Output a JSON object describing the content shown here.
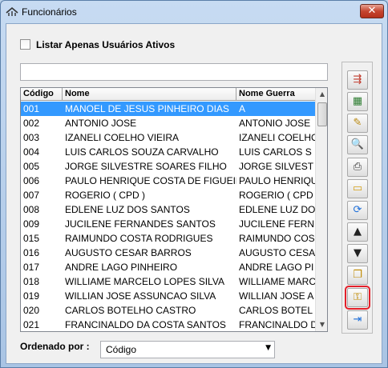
{
  "window": {
    "title": "Funcionários",
    "close_glyph": "✕"
  },
  "filter": {
    "active_only_label": "Listar Apenas Usuários Ativos",
    "active_only_checked": false
  },
  "search": {
    "value": "",
    "placeholder": ""
  },
  "table": {
    "columns": [
      "Código",
      "Nome",
      "Nome Guerra"
    ],
    "selected_row": 0,
    "rows": [
      [
        "001",
        "MANOEL DE JESUS PINHEIRO DIAS",
        "A"
      ],
      [
        "002",
        "ANTONIO JOSE",
        "ANTONIO JOSE"
      ],
      [
        "003",
        "IZANELI COELHO VIEIRA",
        "IZANELI COELHO"
      ],
      [
        "004",
        "LUIS CARLOS SOUZA CARVALHO",
        "LUIS CARLOS S"
      ],
      [
        "005",
        "JORGE SILVESTRE SOARES FILHO",
        "JORGE SILVEST"
      ],
      [
        "006",
        "PAULO HENRIQUE COSTA DE FIGUEIRI",
        "PAULO HENRIQU"
      ],
      [
        "007",
        "ROGERIO ( CPD )",
        "ROGERIO ( CPD"
      ],
      [
        "008",
        "EDLENE LUZ DOS SANTOS",
        "EDLENE LUZ DO"
      ],
      [
        "009",
        "JUCILENE FERNANDES SANTOS",
        "JUCILENE FERN"
      ],
      [
        "015",
        "RAIMUNDO COSTA RODRIGUES",
        "RAIMUNDO COS"
      ],
      [
        "016",
        "AUGUSTO CESAR BARROS",
        "AUGUSTO CESA"
      ],
      [
        "017",
        "ANDRE LAGO PINHEIRO",
        "ANDRE LAGO PI"
      ],
      [
        "018",
        "WILLIAME MARCELO LOPES SILVA",
        "WILLIAME MARC"
      ],
      [
        "019",
        "WILLIAN JOSE ASSUNCAO SILVA",
        "WILLIAN JOSE A"
      ],
      [
        "020",
        "CARLOS BOTELHO CASTRO",
        "CARLOS BOTEL"
      ],
      [
        "021",
        "FRANCINALDO DA COSTA SANTOS",
        "FRANCINALDO D"
      ]
    ]
  },
  "toolbar": {
    "buttons": [
      {
        "name": "insert-row-button",
        "icon": "insert-row-icon",
        "glyph": "⇶",
        "color": "#c0392b"
      },
      {
        "name": "edit-record-button",
        "icon": "edit-grid-icon",
        "glyph": "▦",
        "color": "#2e7d32"
      },
      {
        "name": "eraser-button",
        "icon": "pencil-eraser-icon",
        "glyph": "✎",
        "color": "#b8860b"
      },
      {
        "name": "preview-button",
        "icon": "print-preview-icon",
        "glyph": "🔍",
        "color": "#333333"
      },
      {
        "name": "print-button",
        "icon": "printer-icon",
        "glyph": "⎙",
        "color": "#333333"
      },
      {
        "name": "open-folder-button",
        "icon": "folder-icon",
        "glyph": "▭",
        "color": "#d4a017"
      },
      {
        "name": "refresh-button",
        "icon": "refresh-icon",
        "glyph": "⟳",
        "color": "#1e6fd9"
      },
      {
        "name": "move-up-button",
        "icon": "arrow-up-icon",
        "glyph": "▲",
        "color": "#222222"
      },
      {
        "name": "move-down-button",
        "icon": "arrow-down-icon",
        "glyph": "▼",
        "color": "#222222"
      },
      {
        "name": "copy-button",
        "icon": "copy-icon",
        "glyph": "❐",
        "color": "#c08a00"
      },
      {
        "name": "key-button",
        "icon": "key-icon",
        "glyph": "⚿",
        "color": "#c08a00"
      },
      {
        "name": "exit-button",
        "icon": "exit-door-icon",
        "glyph": "⇥",
        "color": "#1e6fd9"
      }
    ],
    "highlighted_index": 10
  },
  "sort": {
    "label": "Ordenado por :",
    "selected": "Código"
  }
}
